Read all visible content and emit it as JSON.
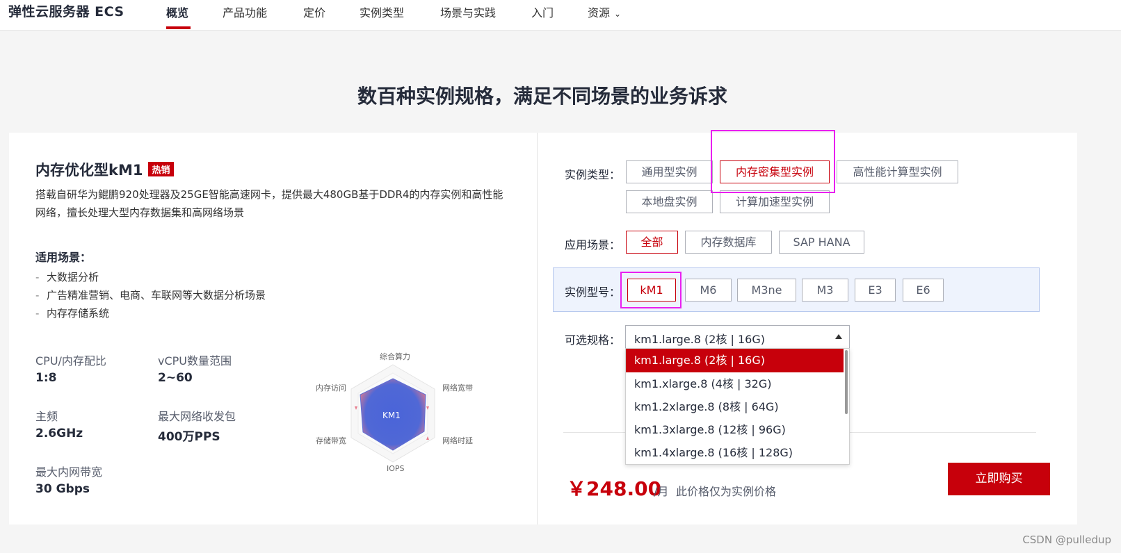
{
  "nav": {
    "brand": "弹性云服务器 ECS",
    "items": [
      "概览",
      "产品功能",
      "定价",
      "实例类型",
      "场景与实践",
      "入门",
      "资源"
    ],
    "active_index": 0
  },
  "headline": "数百种实例规格，满足不同场景的业务诉求",
  "product": {
    "title": "内存优化型kM1",
    "badge": "热销",
    "description": "搭载自研华为鲲鹏920处理器及25GE智能高速网卡，提供最大480GB基于DDR4的内存实例和高性能网络，擅长处理大型内存数据集和高网络场景",
    "scenarios_title": "适用场景：",
    "scenarios": [
      "大数据分析",
      "广告精准营销、电商、车联网等大数据分析场景",
      "内存存储系统"
    ],
    "specs": [
      {
        "label": "CPU/内存配比",
        "value": "1:8"
      },
      {
        "label": "vCPU数量范围",
        "value": "2~60"
      },
      {
        "label": "主频",
        "value": "2.6GHz"
      },
      {
        "label": "最大网络收发包",
        "value": "400万PPS"
      },
      {
        "label": "最大内网带宽",
        "value": "30 Gbps"
      }
    ],
    "radar": {
      "center_label": "KM1",
      "axes": [
        "综合算力",
        "网络宽带",
        "网络时延",
        "IOPS",
        "存储带宽",
        "内存访问"
      ]
    }
  },
  "filters": {
    "instance_type": {
      "label": "实例类型：",
      "options": [
        "通用型实例",
        "内存密集型实例",
        "高性能计算型实例",
        "本地盘实例",
        "计算加速型实例"
      ],
      "selected": "内存密集型实例"
    },
    "scenario": {
      "label": "应用场景：",
      "options": [
        "全部",
        "内存数据库",
        "SAP HANA"
      ],
      "selected": "全部"
    },
    "model": {
      "label": "实例型号：",
      "options": [
        "kM1",
        "M6",
        "M3ne",
        "M3",
        "E3",
        "E6"
      ],
      "selected": "kM1"
    },
    "spec": {
      "label": "可选规格：",
      "current": "km1.large.8 (2核 | 16G)",
      "options": [
        "km1.large.8 (2核 | 16G)",
        "km1.xlarge.8 (4核 | 32G)",
        "km1.2xlarge.8 (8核 | 64G)",
        "km1.3xlarge.8 (12核 | 96G)",
        "km1.4xlarge.8 (16核 | 128G)"
      ]
    }
  },
  "price": {
    "amount": "￥248.00",
    "unit": "/月",
    "note": "此价格仅为实例价格"
  },
  "buy_label": "立即购买",
  "watermark": "CSDN @pulledup",
  "colors": {
    "accent": "#c7000b",
    "highlight": "#e91ff0",
    "radar_fill": "#4a64d8"
  }
}
